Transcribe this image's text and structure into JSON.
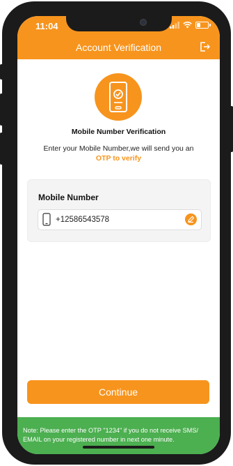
{
  "status_bar": {
    "time": "11:04",
    "battery_level": 0.35
  },
  "header": {
    "title": "Account Verification",
    "logout_icon": "logout-icon"
  },
  "hero": {
    "icon": "phone-check-icon",
    "title": "Mobile Number Verification",
    "subtitle": "Enter your Mobile Number,we will send you an",
    "highlight": "OTP to verify"
  },
  "card": {
    "label": "Mobile Number",
    "value": "+12586543578",
    "input_icon": "mobile-icon",
    "edit_icon": "edit-icon"
  },
  "actions": {
    "continue_label": "Continue"
  },
  "note": {
    "text": "Note: Please enter the OTP \"1234\" if you do not receive SMS/ EMAIL on your registered number in next one minute."
  },
  "colors": {
    "accent": "#f7941d",
    "note_bar": "#4caf50",
    "frame": "#1b1b1b"
  }
}
